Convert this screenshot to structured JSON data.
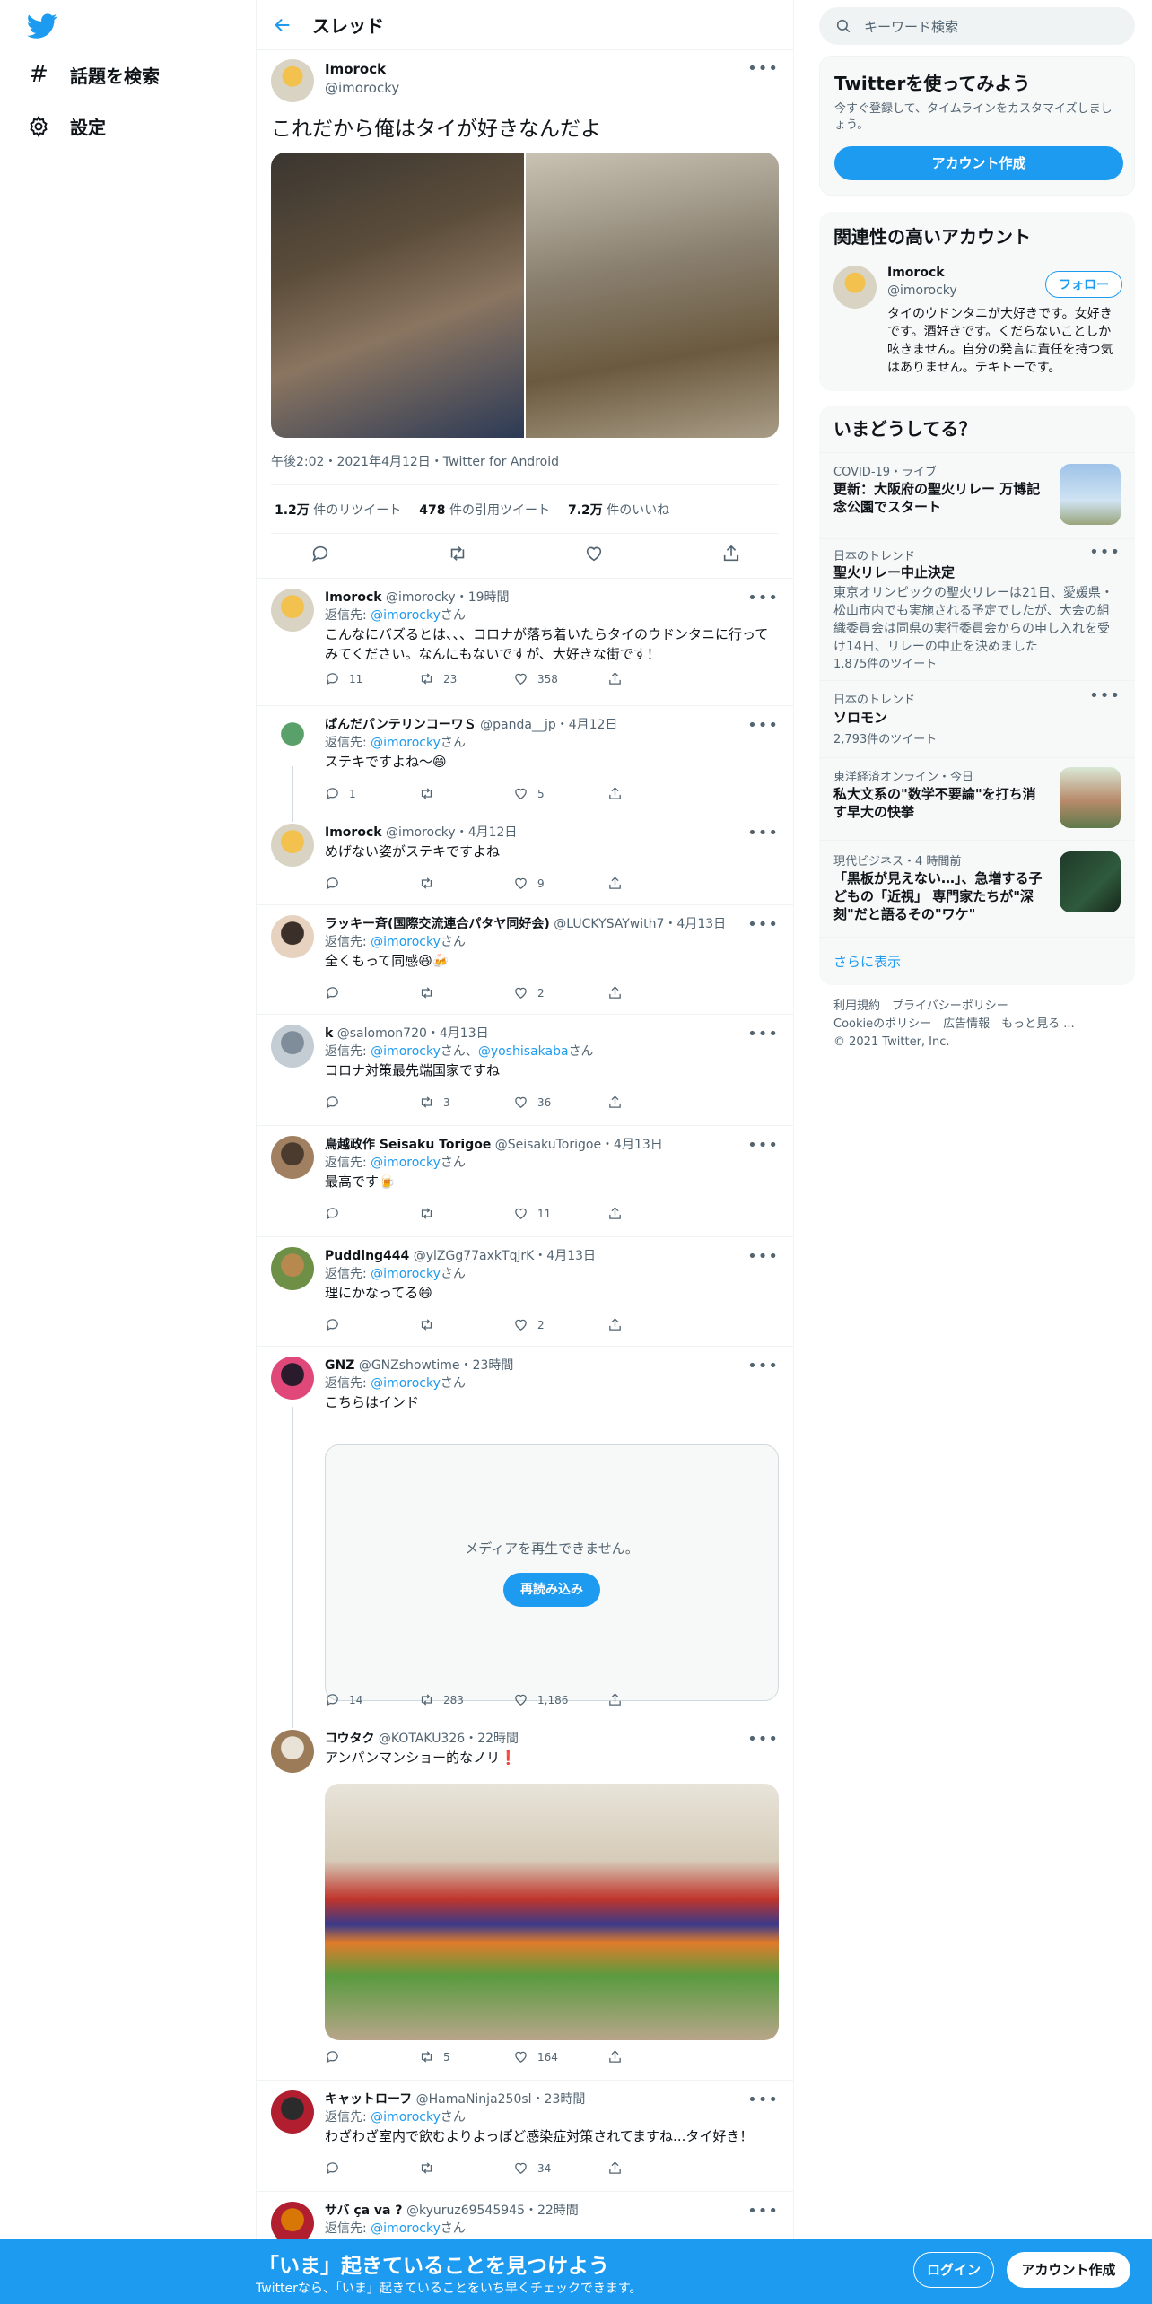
{
  "nav": {
    "explore": "話題を検索",
    "settings": "設定"
  },
  "header": {
    "title": "スレッド"
  },
  "tweet": {
    "name": "Imorock",
    "handle": "@imorocky",
    "text": "これだから俺はタイが好きなんだよ",
    "meta": "午後2:02・2021年4月12日・Twitter for Android",
    "stats": {
      "retweets_num": "1.2万",
      "retweets_label": "件のリツイート",
      "quotes_num": "478",
      "quotes_label": "件の引用ツイート",
      "likes_num": "7.2万",
      "likes_label": "件のいいね"
    }
  },
  "replies": [
    {
      "name": "Imorock",
      "handle": "@imorocky・19時間",
      "reply_to_prefix": "返信先: ",
      "reply_to": "@imorocky",
      "reply_to_suffix": "さん",
      "text": "こんなにバズるとは、、、コロナが落ち着いたらタイのウドンタニに行ってみてください。なんにもないですが、大好きな街です！",
      "counts": {
        "reply": "11",
        "retweet": "23",
        "like": "358"
      }
    },
    {
      "name": "ぱんだパンテリンコーワＳ",
      "handle": "@panda__jp・4月12日",
      "reply_to_prefix": "返信先: ",
      "reply_to": "@imorocky",
      "reply_to_suffix": "さん",
      "text": "ステキですよね～😄",
      "counts": {
        "reply": "1",
        "retweet": "",
        "like": "5"
      }
    },
    {
      "name": "Imorock",
      "handle": "@imorocky・4月12日",
      "text": "めげない姿がステキですよね",
      "counts": {
        "reply": "",
        "retweet": "",
        "like": "9"
      }
    },
    {
      "name": "ラッキー斉(国際交流連合パタヤ同好会)",
      "handle": "@LUCKYSAYwith7・4月13日",
      "reply_to_prefix": "返信先: ",
      "reply_to": "@imorocky",
      "reply_to_suffix": "さん",
      "text": "全くもって同感😆🍻",
      "counts": {
        "reply": "",
        "retweet": "",
        "like": "2"
      }
    },
    {
      "name": "k",
      "handle": "@salomon720・4月13日",
      "reply_to_prefix": "返信先: ",
      "reply_to": "@imorocky",
      "reply_to_mid": "さん、",
      "reply_to2": "@yoshisakaba",
      "reply_to_suffix": "さん",
      "text": "コロナ対策最先端国家ですね",
      "counts": {
        "reply": "",
        "retweet": "3",
        "like": "36"
      }
    },
    {
      "name": "鳥越政作 Seisaku Torigoe",
      "handle": "@SeisakuTorigoe・4月13日",
      "reply_to_prefix": "返信先: ",
      "reply_to": "@imorocky",
      "reply_to_suffix": "さん",
      "text": "最高です🍺",
      "counts": {
        "reply": "",
        "retweet": "",
        "like": "11"
      }
    },
    {
      "name": "Pudding444",
      "handle": "@ylZGg77axkTqjrK・4月13日",
      "reply_to_prefix": "返信先: ",
      "reply_to": "@imorocky",
      "reply_to_suffix": "さん",
      "text": "理にかなってる😄",
      "counts": {
        "reply": "",
        "retweet": "",
        "like": "2"
      }
    },
    {
      "name": "GNZ",
      "handle": "@GNZshowtime・23時間",
      "reply_to_prefix": "返信先: ",
      "reply_to": "@imorocky",
      "reply_to_suffix": "さん",
      "text": "こちらはインド",
      "media_error": "メディアを再生できません。",
      "reload": "再読み込み",
      "counts": {
        "reply": "14",
        "retweet": "283",
        "like": "1,186"
      }
    },
    {
      "name": "コウタク",
      "handle": "@KOTAKU326・22時間",
      "text": "アンパンマンショー的なノリ❗",
      "counts": {
        "reply": "",
        "retweet": "5",
        "like": "164"
      }
    },
    {
      "name": "キャットローフ",
      "handle": "@HamaNinja250sl・23時間",
      "reply_to_prefix": "返信先: ",
      "reply_to": "@imorocky",
      "reply_to_suffix": "さん",
      "text": "わざわざ室内で飲むよりよっぽど感染症対策されてますね...タイ好き！",
      "counts": {
        "reply": "",
        "retweet": "",
        "like": "34"
      }
    },
    {
      "name": "サバ ça va ?",
      "handle": "@kyuruz69545945・22時間",
      "reply_to_prefix": "返信先: ",
      "reply_to": "@imorocky",
      "reply_to_suffix": "さん"
    }
  ],
  "right": {
    "search_placeholder": "キーワード検索",
    "signup": {
      "title": "Twitterを使ってみよう",
      "desc": "今すぐ登録して、タイムラインをカスタマイズしましょう。",
      "button": "アカウント作成"
    },
    "relevant": {
      "title": "関連性の高いアカウント",
      "name": "Imorock",
      "handle": "@imorocky",
      "follow": "フォロー",
      "bio": "タイのウドンタニが大好きです。女好きです。酒好きです。くだらないことしか呟きません。自分の発言に責任を持つ気はありません。テキトーです。"
    },
    "trends": {
      "title": "いまどうしてる？",
      "items": [
        {
          "context": "COVID-19・ライブ",
          "headline": "更新：大阪府の聖火リレー 万博記念公園でスタート"
        },
        {
          "context": "日本のトレンド",
          "headline": "聖火リレー中止決定",
          "desc": "東京オリンピックの聖火リレーは21日、愛媛県・松山市内でも実施される予定でしたが、大会の組織委員会は同県の実行委員会からの申し入れを受け14日、リレーの中止を決めました",
          "count": "1,875件のツイート"
        },
        {
          "context": "日本のトレンド",
          "headline": "ソロモン",
          "count": "2,793件のツイート"
        },
        {
          "context": "東洋経済オンライン・今日",
          "headline": "私大文系の\"数学不要論\"を打ち消す早大の快挙"
        },
        {
          "context": "現代ビジネス・4 時間前",
          "headline": "「黒板が見えない…」、急増する子どもの「近視」 専門家たちが\"深刻\"だと語るその\"ワケ\""
        }
      ],
      "more": "さらに表示"
    },
    "footer": {
      "line1": "利用規約　プライバシーポリシー",
      "line2": "Cookieのポリシー　広告情報　もっと見る ...",
      "line3": "© 2021 Twitter, Inc."
    }
  },
  "bottom": {
    "title": "「いま」起きていることを見つけよう",
    "subtitle": "Twitterなら、「いま」起きていることをいち早くチェックできます。",
    "login": "ログイン",
    "signup": "アカウント作成"
  },
  "colors": {
    "accent": "#1d9bf0",
    "bottom_bar": "#1d9bf0"
  }
}
